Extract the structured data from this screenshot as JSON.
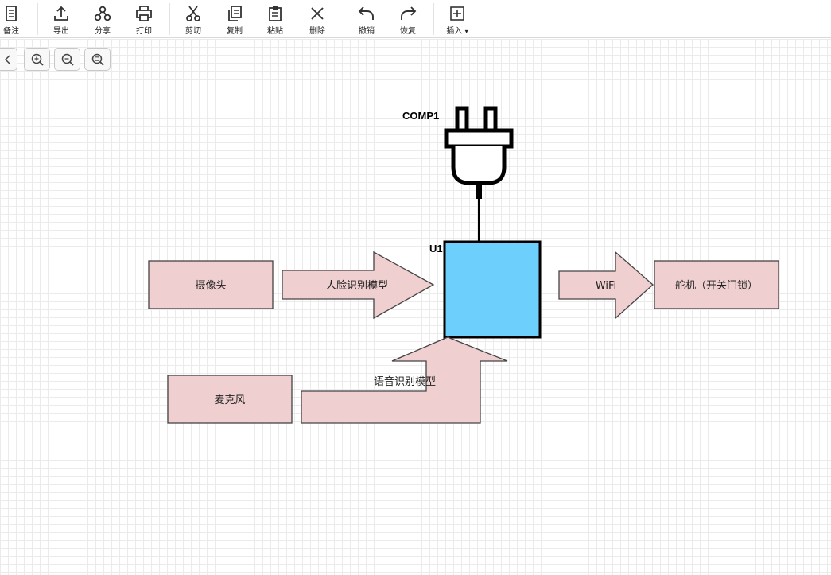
{
  "toolbar": {
    "note": "备注",
    "export": "导出",
    "share": "分享",
    "print": "打印",
    "cut": "剪切",
    "copy": "复制",
    "paste": "粘贴",
    "delete": "删除",
    "undo": "撤销",
    "redo": "恢复",
    "insert": "插入",
    "insert_arrow": "▾"
  },
  "diagram": {
    "comp1_label": "COMP1",
    "u1_label": "U1",
    "camera": "摄像头",
    "face_model": "人脸识别模型",
    "wifi": "WiFi",
    "servo": "舵机（开关门锁）",
    "mic": "麦克风",
    "voice_model": "语音识别模型"
  },
  "colors": {
    "box_fill": "#efcfcf",
    "box_stroke": "#444444",
    "chip_fill": "#6ccffc",
    "chip_stroke": "#000000"
  }
}
